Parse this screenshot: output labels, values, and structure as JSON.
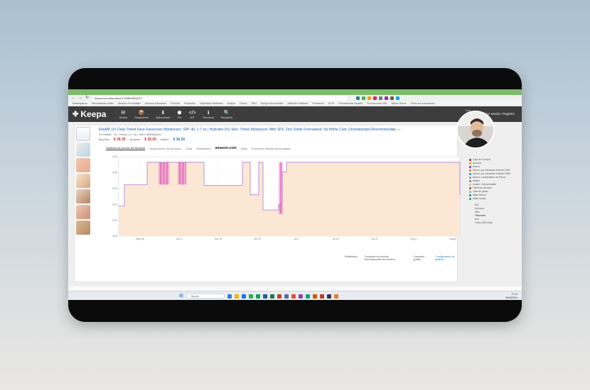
{
  "browser": {
    "url": "keepa.com/#!product/1-B08DB5Q2ZJ",
    "bookmarks": [
      "Marketplaces",
      "Herramientas Seller",
      "Amazon Pro Analisis",
      "Amazon Educacion",
      "Formato",
      "Productos",
      "Calendario Webinars",
      "Amigos",
      "Ozono",
      "SEO",
      "Equipo Documentos",
      "Afiliación Software",
      "Formación",
      "UCHI",
      "Herramientas España",
      "Formaciones USA",
      "Banco Nexus",
      "Todos los marcadores"
    ]
  },
  "keepa": {
    "logo": "Keepa",
    "nav": [
      "Ofertas",
      "Seguimiento",
      "Aplicaciones",
      "Pro",
      "API",
      "Recursos",
      "Búsqueda"
    ],
    "hello": "Hola",
    "login": "Iniciar sesión / Registro"
  },
  "product": {
    "title": "EltaMD UV Daily Tinted Face Sunscreen Moisturizer, SPF 40, 1.7 oz | Hydrates Dry Skin, Tinted Moisturizer With SPF, Zinc Oxide Formulated, No White Cast, Dermatologist Recommended",
    "meta": "Por EltaMD · UV · Pedido: (1.7 oz) · ASIN: B08DB5Q2ZJ",
    "buy_box_label": "Buy Box",
    "buy_box_price": "$ 36.39",
    "amazon_label": "Amazon",
    "amazon_price": "$ 36.55",
    "new_label": "Nuevo",
    "new_price": "$ 36.55",
    "rating": "★★★★☆"
  },
  "tabs": [
    "Historial de precios de Amazon",
    "Seguimiento del producto",
    "Data",
    "Variaciones",
    "amazon.com",
    "eBay",
    "Encontrar ofertas relacionadas"
  ],
  "chart_data": {
    "type": "line",
    "x_ticks": [
      "May 26",
      "Jun 1",
      "Jun 15",
      "Jun 22",
      "Jul 1",
      "Jul 15",
      "Jul 22",
      "Aug 1",
      "Aug 8"
    ],
    "y_ticks": [
      "$ 40",
      "$ 38",
      "$ 36",
      "$ 34",
      "$ 32",
      "$ 30"
    ],
    "ylim": [
      30,
      40
    ],
    "series": [
      {
        "name": "Amazon",
        "x": [
          0,
          8,
          8,
          40,
          40,
          120,
          120,
          174,
          174,
          185,
          185,
          197,
          197,
          203,
          203,
          225,
          225,
          230,
          230,
          236,
          236,
          480,
          480
        ],
        "values": [
          33.8,
          33.8,
          36.5,
          36.5,
          39.3,
          39.3,
          36.4,
          36.4,
          39.3,
          39.3,
          35.2,
          35.2,
          39.3,
          39.3,
          33.3,
          33.3,
          34.0,
          34.0,
          38.1,
          38.1,
          39.3,
          39.3,
          35.2
        ]
      }
    ],
    "spike_ranges": [
      [
        57,
        70
      ],
      [
        84,
        95
      ],
      [
        226,
        231
      ]
    ],
    "legend": [
      "Caja de Compra",
      "Amazon",
      "Nuevo",
      "Nuevo, por Vendedor Externo FBA",
      "Nuevo, por Vendedor Externo FBM",
      "Nuevo, Lanzamiento de Precio",
      "Usado",
      "Usado, Coleccionable",
      "Oferta de Amazon",
      "Lista de precio",
      "eBay Nuevo",
      "eBay Usado"
    ],
    "range_labels": [
      "Día",
      "Semana",
      "Mes",
      "Trimestre",
      "Año",
      "Todo (-469 días)"
    ],
    "grid": true
  },
  "chart_colors": {
    "amazon_fill": "#fbe7d4",
    "amazon_line": "#9b6bd6",
    "spike": "#d62fb3"
  },
  "footer": {
    "stats": "Estadística",
    "compare": "Comparar los precios internacionales de Amazon",
    "share": "Compartir gráfico",
    "config": "Configuración de gráficos"
  },
  "taskbar": {
    "search": "Buscar",
    "time": "17:12",
    "date": "26/08/2024"
  }
}
